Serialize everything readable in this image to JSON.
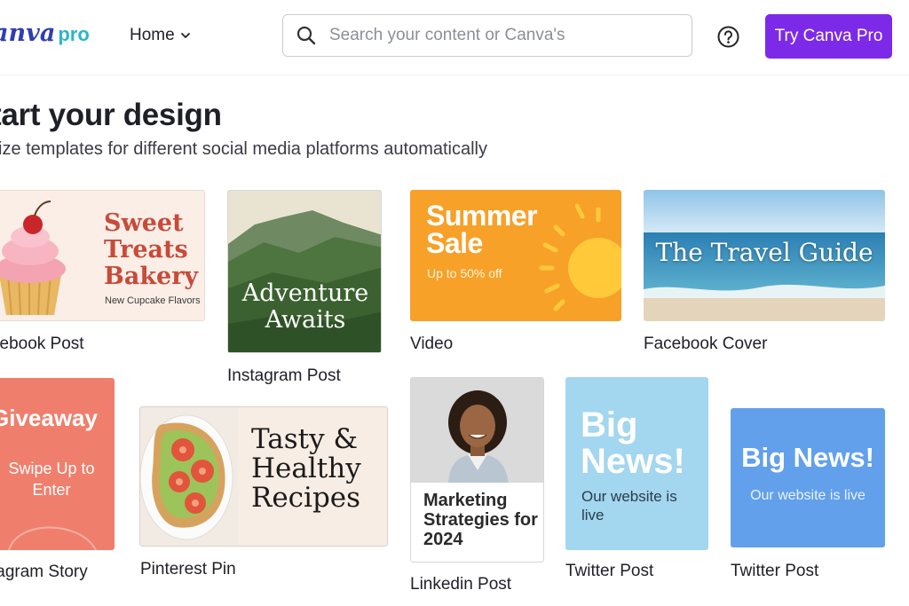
{
  "header": {
    "logo_main": "anva",
    "logo_pro": "pro",
    "home_label": "Home",
    "search_placeholder": "Search your content or Canva's",
    "try_pro_label": "Try Canva Pro",
    "accent": "#7d2ae8"
  },
  "intro": {
    "title": "tart your design",
    "subtitle": "size templates for different social media platforms automatically"
  },
  "templates": [
    {
      "type_label": "cebook Post",
      "heading": "Sweet Treats Bakery",
      "sub": "New Cupcake Flavors",
      "icon": "cupcake-icon"
    },
    {
      "type_label": "Instagram Post",
      "heading": "Adventure Awaits",
      "icon": "mountain-icon"
    },
    {
      "type_label": "Video",
      "heading": "Summer Sale",
      "sub": "Up to 50% off",
      "icon": "sun-icon"
    },
    {
      "type_label": "Facebook Cover",
      "heading": "The Travel Guide",
      "icon": "ocean-icon"
    },
    {
      "type_label": "tagram Story",
      "heading": "Giveaway",
      "sub": "Swipe Up to Enter"
    },
    {
      "type_label": "Pinterest Pin",
      "heading": "Tasty & Healthy Recipes",
      "icon": "avocado-toast-icon"
    },
    {
      "type_label": "Linkedin Post",
      "heading": "Marketing Strategies for 2024",
      "icon": "portrait-icon"
    },
    {
      "type_label": "Twitter Post",
      "heading": "Big News!",
      "sub": "Our website is live"
    },
    {
      "type_label": "Twitter Post",
      "heading": "Big News!",
      "sub": "Our website is live"
    }
  ]
}
